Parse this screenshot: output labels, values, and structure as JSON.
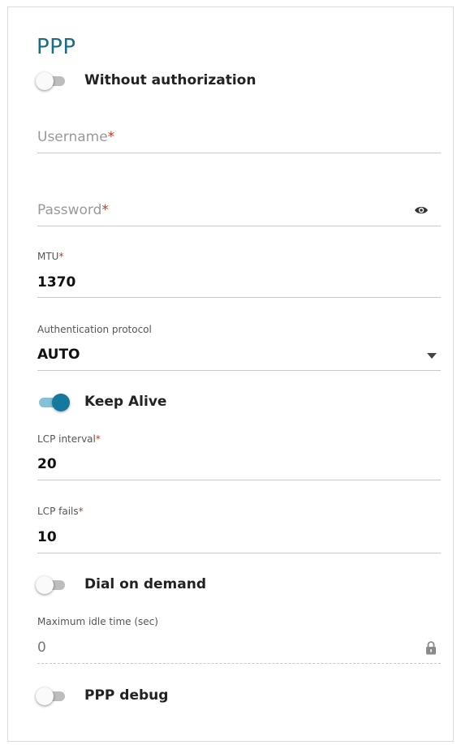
{
  "title": "PPP",
  "toggles": {
    "without_authorization": {
      "label": "Without authorization",
      "on": false
    },
    "keep_alive": {
      "label": "Keep Alive",
      "on": true
    },
    "dial_on_demand": {
      "label": "Dial on demand",
      "on": false
    },
    "ppp_debug": {
      "label": "PPP debug",
      "on": false
    }
  },
  "fields": {
    "username": {
      "placeholder": "Username",
      "required_mark": "*",
      "value": ""
    },
    "password": {
      "placeholder": "Password",
      "required_mark": "*",
      "value": "",
      "icon": "eye-icon"
    },
    "mtu": {
      "label": "MTU",
      "required_mark": "*",
      "value": "1370"
    },
    "auth_protocol": {
      "label": "Authentication protocol",
      "value": "AUTO",
      "icon": "chevron-down-icon"
    },
    "lcp_interval": {
      "label": "LCP interval",
      "required_mark": "*",
      "value": "20"
    },
    "lcp_fails": {
      "label": "LCP fails",
      "required_mark": "*",
      "value": "10"
    },
    "max_idle_time": {
      "label": "Maximum idle time (sec)",
      "value": "0",
      "icon": "lock-icon",
      "disabled": true
    }
  },
  "colors": {
    "accent": "#14799c",
    "title": "#1a6d87",
    "required": "#c0392b"
  }
}
